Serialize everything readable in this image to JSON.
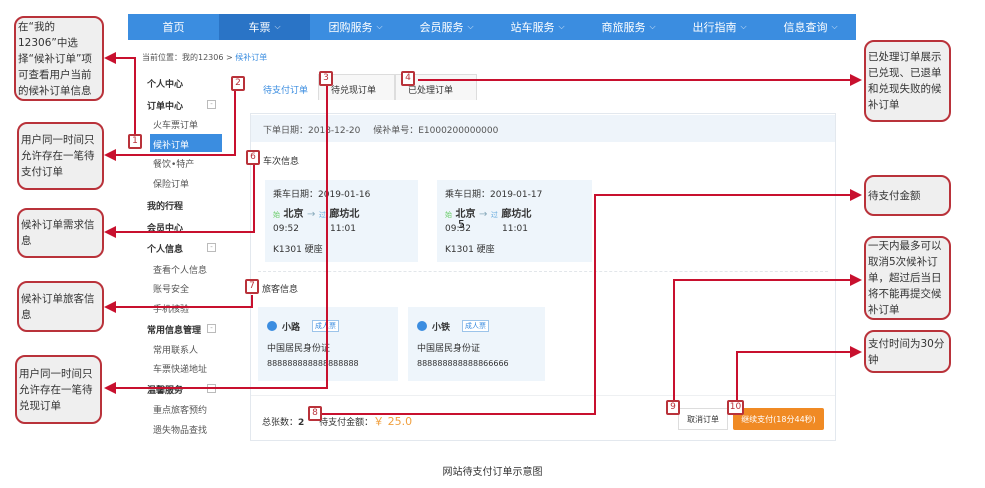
{
  "nav": [
    "首页",
    "车票",
    "团购服务",
    "会员服务",
    "站车服务",
    "商旅服务",
    "出行指南",
    "信息查询"
  ],
  "breadcrumb": {
    "prefix": "当前位置：我的12306 > ",
    "current": "候补订单"
  },
  "sidebar": {
    "personal_center": "个人中心",
    "order_center": "订单中心",
    "train_orders": "火车票订单",
    "waitlist_orders": "候补订单",
    "catering": "餐饮•特产",
    "insurance": "保险订单",
    "my_trips": "我的行程",
    "member_center": "会员中心",
    "personal_info": "个人信息",
    "view_info": "查看个人信息",
    "account_security": "账号安全",
    "phone_verify": "手机核验",
    "common_info": "常用信息管理",
    "contacts": "常用联系人",
    "address": "车票快递地址",
    "care_service": "温馨服务",
    "priority": "重点旅客预约",
    "lost_found": "遗失物品查找"
  },
  "tabs": [
    "待支付订单",
    "待兑现订单",
    "已处理订单"
  ],
  "order": {
    "date_label": "下单日期：",
    "date": "2018-12-20",
    "no_label": "候补单号：",
    "no": "E1000200000000"
  },
  "train_section": "车次信息",
  "trains": [
    {
      "date_label": "乘车日期：",
      "date": "2019-01-16",
      "start_tag": "始",
      "from": "北京",
      "pass_tag": "过",
      "to": "廊坊北",
      "dep": "09:52",
      "arr": "11:01",
      "train": "K1301 硬座"
    },
    {
      "date_label": "乘车日期：",
      "date": "2019-01-17",
      "start_tag": "始",
      "from": "北京",
      "pass_tag": "过",
      "to": "廊坊北",
      "dep": "09:52",
      "arr": "11:01",
      "train": "K1301 硬座"
    }
  ],
  "passenger_section": "旅客信息",
  "passengers": [
    {
      "name": "小路",
      "type": "成人票",
      "id_type": "中国居民身份证",
      "id": "888888888888888888"
    },
    {
      "name": "小铁",
      "type": "成人票",
      "id_type": "中国居民身份证",
      "id": "888888888888866666"
    }
  ],
  "footer": {
    "count_label": "总张数：",
    "count": "2",
    "amount_label": "待支付金额：",
    "amount": "￥ 25.0",
    "cancel": "取消订单",
    "pay": "继续支付(18分44秒)"
  },
  "markers": [
    "1",
    "2",
    "3",
    "4",
    "5",
    "6",
    "7",
    "8",
    "9",
    "10"
  ],
  "callouts": {
    "c1": "在“我的12306”中选择“候补订单”项可查看用户当前的候补订单信息",
    "c2": "用户同一时间只允许存在一笔待支付订单",
    "c3": "候补订单需求信息",
    "c4": "候补订单旅客信息",
    "c5": "用户同一时间只允许存在一笔待兑现订单",
    "r1": "已处理订单展示已兑现、已退单和兑现失败的候补订单",
    "r2": "待支付金额",
    "r3": "一天内最多可以取消5次候补订单，超过后当日将不能再提交候补订单",
    "r4": "支付时间为30分钟"
  },
  "caption": "网站待支付订单示意图",
  "colors": {
    "nav": "#3b8de0",
    "accent": "#b9323a",
    "pay": "#f08a24"
  }
}
